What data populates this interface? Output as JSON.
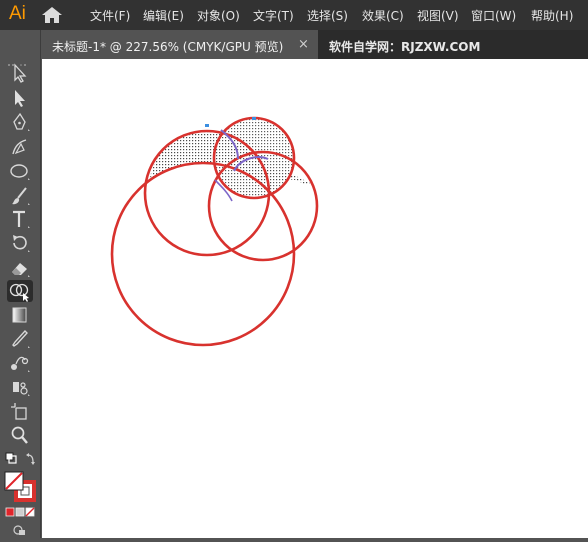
{
  "app": {
    "logo": "Ai"
  },
  "menu": [
    "文件(F)",
    "编辑(E)",
    "对象(O)",
    "文字(T)",
    "选择(S)",
    "效果(C)",
    "视图(V)",
    "窗口(W)",
    "帮助(H)"
  ],
  "tab": {
    "title": "未标题-1* @ 227.56% (CMYK/GPU 预览)",
    "close": "×"
  },
  "watermark": "软件自学网：RJZXW.COM",
  "tools": [
    "selection-tool",
    "direct-selection-tool",
    "pen-tool",
    "curvature-tool",
    "ellipse-tool",
    "paintbrush-tool",
    "type-tool",
    "rotate-tool",
    "eraser-tool",
    "shape-builder-tool",
    "gradient-tool",
    "eyedropper-tool",
    "blend-tool",
    "symbol-sprayer-tool",
    "artboard-tool",
    "zoom-tool"
  ],
  "colors": {
    "stroke": "#D8322E",
    "fill": "none",
    "accent": "#FF9A00"
  },
  "canvas": {
    "shapes": [
      "circle-large",
      "circle-medium-left",
      "circle-medium-right",
      "circle-small-top"
    ],
    "active_tool": "shape-builder-tool"
  }
}
